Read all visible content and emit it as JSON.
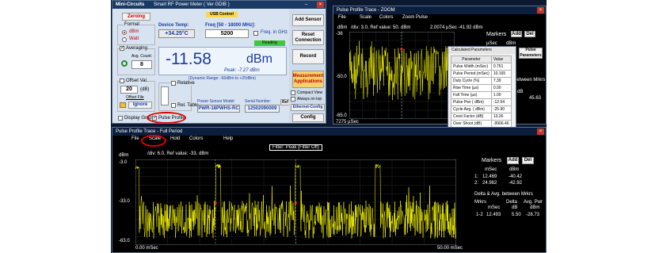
{
  "meter": {
    "title": "Smart RF Power Meter  ( Ver GDIB )",
    "brand": "Mini-Circuits",
    "zeroing": "Zeroing",
    "usb_control": "USB Control",
    "device_temp_label": "Device Temp:",
    "device_temp": "+34.25°C",
    "freq_label": "Freq [50 - 18000 MHz]:",
    "freq": "5200",
    "freq_ghz_label": "Freq. in GHz",
    "reading_label": "Reading",
    "format_label": "Format",
    "format_dbm": "dBm",
    "format_watt": "Watt",
    "averaging_label": "Averaging",
    "avg_count_label": "Avg. Count:",
    "avg_count": "8",
    "reading_value": "-11.58",
    "reading_unit": "dBm",
    "peak_text": "Peak: -7.27 dBm",
    "dynamic_range": "(Dynamic Range: -60dBm to +20dBm)",
    "offset_val_label": "Offset Val.",
    "offset_val": "20",
    "offset_unit": "(dB)",
    "offset_file_label": "Offset File",
    "ignore_label": "Ignore",
    "relative_label": "Relative",
    "rel_table_label": "Rel. Table",
    "sensor_model_label": "Power Sensor Model:",
    "sensor_model": "PWR-18PWHS-RC",
    "serial_label": "Serial Number:",
    "serial": "12502090009",
    "ref_label": "Ref",
    "compact_view_label": "Compact View",
    "always_on_top_label": "Always on top",
    "display_graph_label": "Display Graph",
    "pulse_profile_label": "Pulse Profile",
    "add_sensor": "Add Sensor",
    "reset_connection": "Reset Connection",
    "record": "Record",
    "measurement_apps": "Measurement Applications",
    "ethernet_config": "Ethernet-Config",
    "config": "Config"
  },
  "zoom": {
    "title": "Pulse Profile Trace - ZOOM",
    "menu": [
      "File",
      "Scale",
      "Colors",
      "Zoom Pulse"
    ],
    "ylabel": "dBm",
    "header_text": "/div: 3.0, Ref value: 50. dBm",
    "marker_readout": "2.0074 µSec   -41.92 dBm",
    "y_ticks": [
      "-36",
      "-50.0",
      "-65.0"
    ],
    "x_tick_left": "7275 µSec",
    "markers_label": "Markers",
    "add_label": "Add",
    "del_label": "Del",
    "usec_label": "µSec",
    "dbm_label": "dBm",
    "pulse_params_label": "Pulse Parameters",
    "between_label": "between Mrkrs",
    "db_label": "dB",
    "right_value": "45.63"
  },
  "calc": {
    "title": "Calculated Parameters",
    "col_param": "Parameter",
    "col_value": "Value",
    "rows": [
      [
        "Pulse Width (mSec)",
        "0.751"
      ],
      [
        "Pulse Period (mSec)",
        "10.165"
      ],
      [
        "Duty Cycle (%)",
        "7.39"
      ],
      [
        "Rise Time (µs)",
        "0.00"
      ],
      [
        "Fall Time (µs)",
        "1.00"
      ],
      [
        "Pulse Pwr ( dBm)",
        "-12.54"
      ],
      [
        "Cycle Avg. ( dBm)",
        "-25.90"
      ],
      [
        "Crest Factor (dB)",
        "13.36"
      ],
      [
        "Over Shoot (dB)",
        "-9966.46"
      ]
    ]
  },
  "full": {
    "title": "Pulse Profile Trace - Full Period",
    "menu": [
      "File",
      "Scale",
      "Hold",
      "Colors",
      "Help"
    ],
    "filter_label": "Filter: Peak (Filter Off)",
    "header_text": "/div: 6.0, Ref value: -33. dBm",
    "ylabel": "dBm",
    "y_ticks": [
      "-3.0",
      "-33.0",
      "-63.0"
    ],
    "x_tick_left": "0.00 mSec",
    "x_tick_right": "50.00 mSec",
    "markers_label": "Markers",
    "add_label": "Add",
    "del_label": "Del",
    "msec_label": "mSec",
    "dbm_label": "dBm",
    "marker_rows": [
      [
        "1:",
        "12.469",
        "-40.42"
      ],
      [
        "2:",
        "24.962",
        "-42.92"
      ]
    ],
    "delta_title": "Delta & Avg. between Mrkrs",
    "delta_header": [
      "Mrkrs",
      "Delta",
      "Avg. Pwr"
    ],
    "delta_units": [
      "mSec",
      "dB",
      "dBm"
    ],
    "delta_row": [
      "1-2",
      "12.493",
      "5.50",
      "-28.73"
    ]
  },
  "colors": {
    "trace": "#ffff00",
    "plot_bg": "#000000",
    "title_bar": "#1a3a66",
    "meter_bg": "#d7e3f0",
    "reading_text": "#1a3aa0",
    "highlight_ellipse": "#e00000",
    "marker": "#ff3030",
    "close_red": "#c0392b"
  },
  "traces": {
    "zoom_noise_seed": 7,
    "full_pulses_msec": [
      12.5,
      24.9,
      37.4
    ]
  }
}
